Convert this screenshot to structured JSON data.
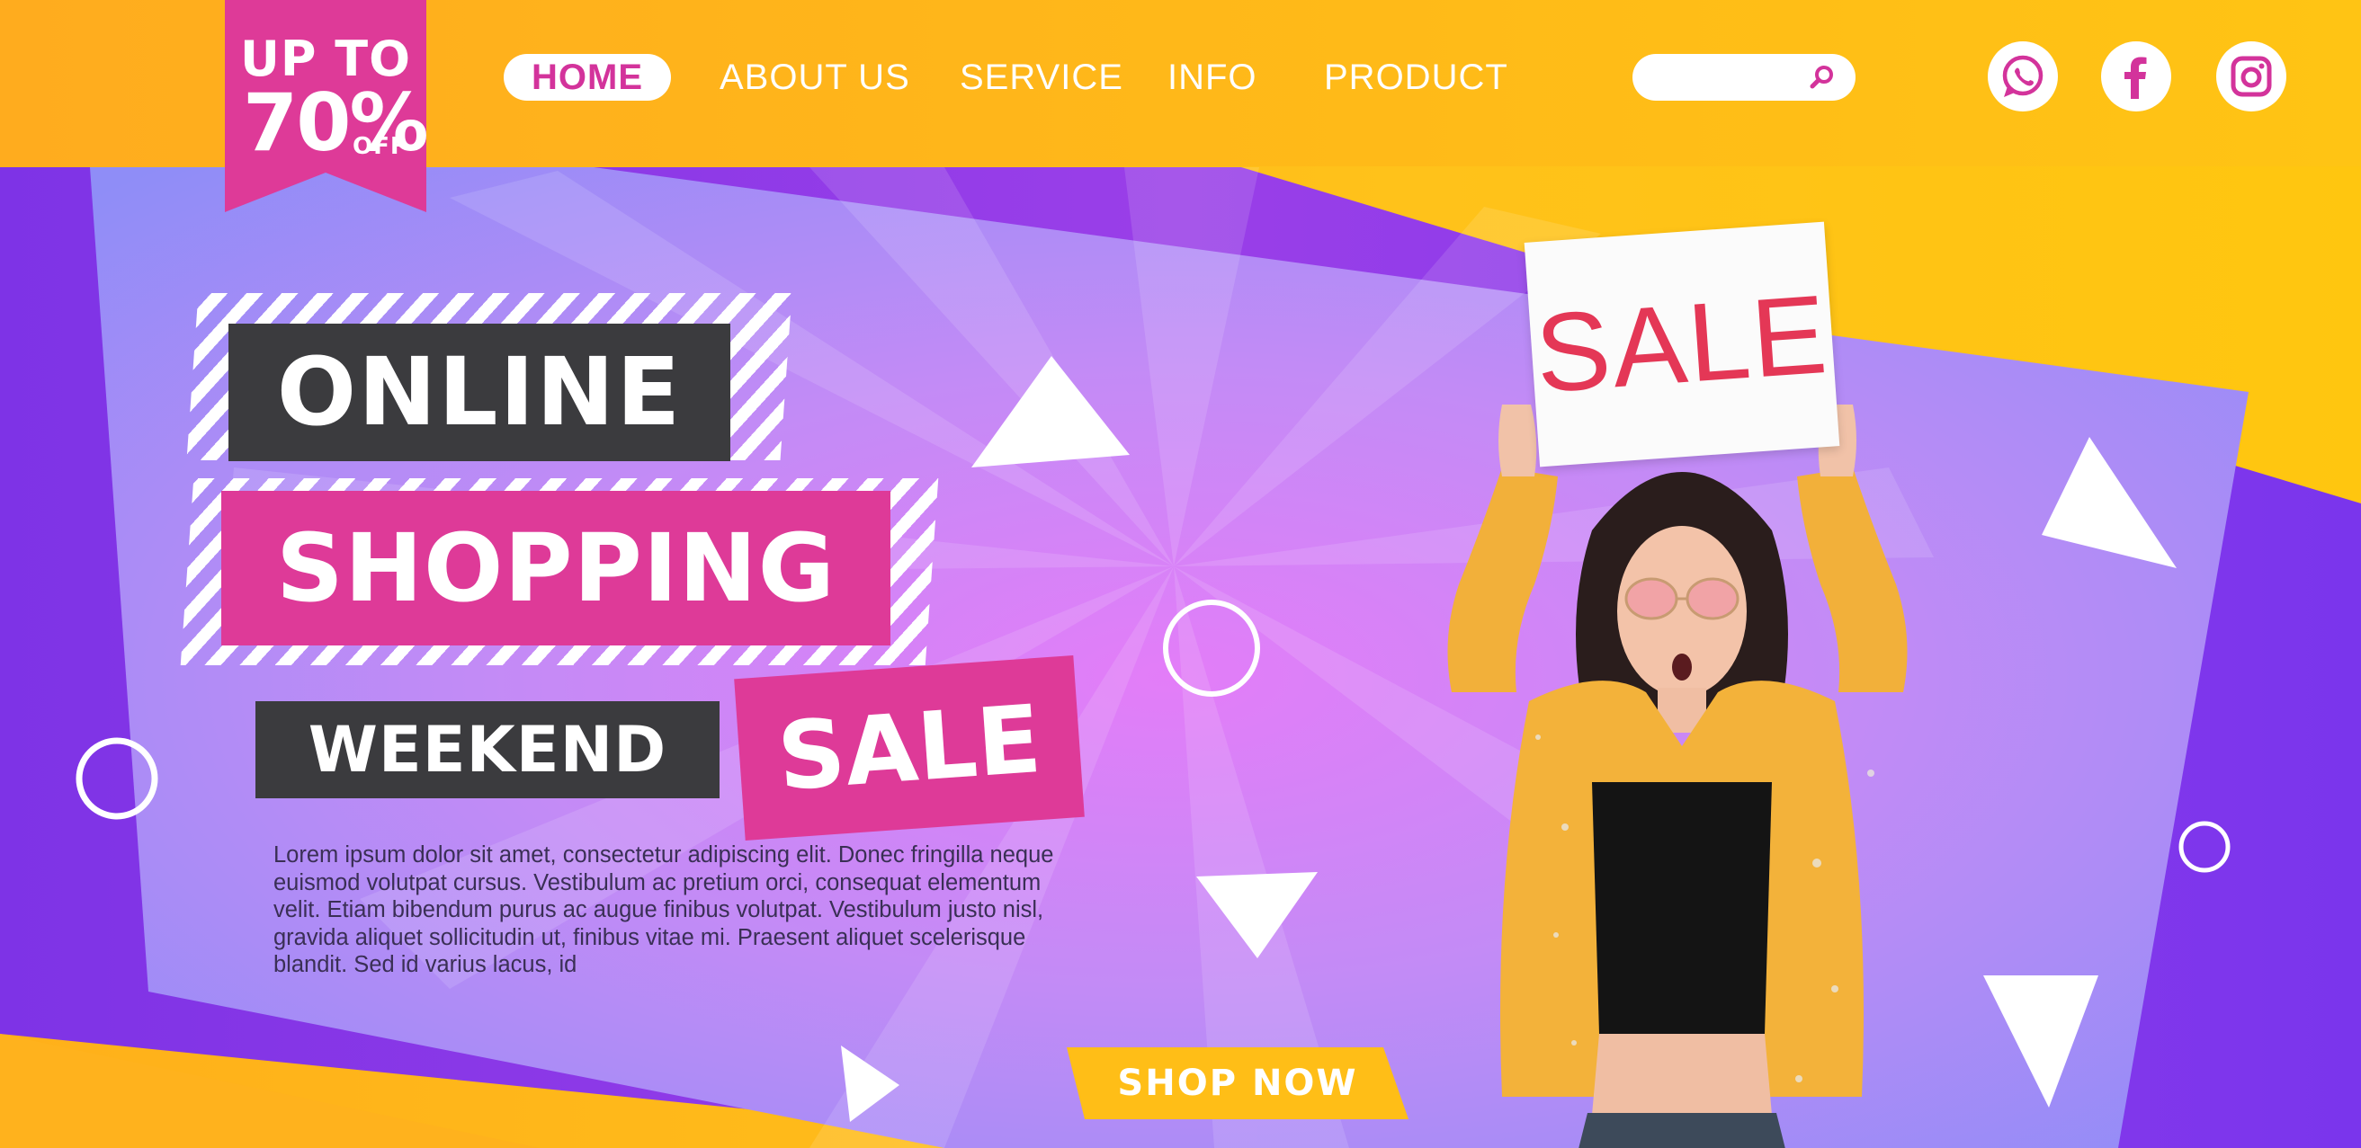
{
  "promo": {
    "line1": "UP TO",
    "percent": "70%",
    "off": "OFF"
  },
  "nav": {
    "items": [
      {
        "label": "HOME",
        "active": true
      },
      {
        "label": "ABOUT US"
      },
      {
        "label": "SERVICE"
      },
      {
        "label": "INFO"
      },
      {
        "label": "PRODUCT"
      }
    ]
  },
  "search": {
    "placeholder": ""
  },
  "social": [
    "whatsapp-icon",
    "facebook-icon",
    "instagram-icon"
  ],
  "hero": {
    "line1": "ONLINE",
    "line2": "SHOPPING",
    "line3a": "WEEKEND",
    "line3b": "SALE",
    "body": "Lorem ipsum dolor sit amet, consectetur adipiscing elit. Donec fringilla neque euismod volutpat cursus. Vestibulum ac pretium orci, consequat elementum velit. Etiam bibendum purus ac augue finibus volutpat. Vestibulum justo nisl, gravida aliquet sollicitudin ut, finibus vitae mi. Praesent aliquet scelerisque blandit. Sed id varius lacus, id",
    "cta": "SHOP NOW",
    "sign_text": "SALE"
  },
  "colors": {
    "orange": "#ffb01a",
    "magenta": "#de3a98",
    "dark": "#3b3b3e",
    "purple": "#8a3be6",
    "lilac": "#c98cf6",
    "cta_yellow": "#ffbe17",
    "jacket": "#f3b23a"
  }
}
